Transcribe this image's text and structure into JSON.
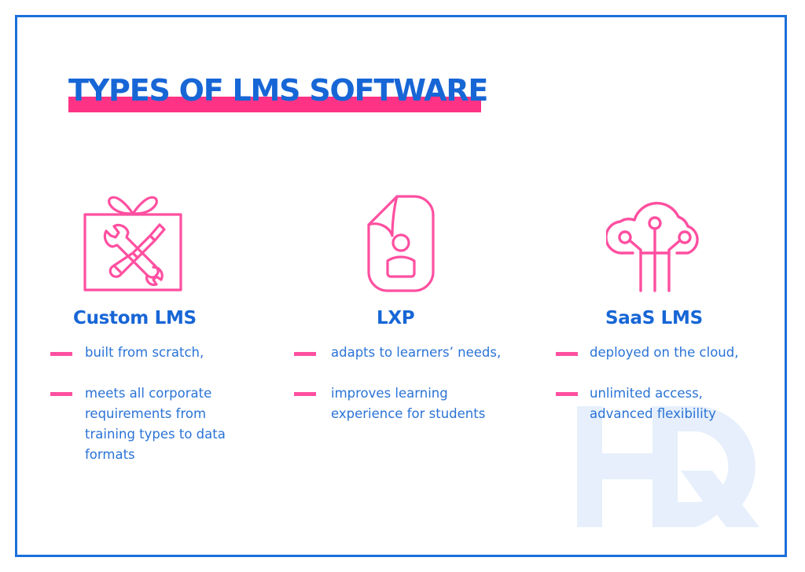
{
  "title": "TYPES OF LMS SOFTWARE",
  "colors": {
    "primary_blue": "#1766d6",
    "text_blue": "#2a73d6",
    "accent_pink": "#ff3386",
    "icon_pink": "#ff4fa0",
    "watermark_blue": "#e6effb"
  },
  "watermark": {
    "text": "HQ"
  },
  "columns": [
    {
      "heading": "Custom LMS",
      "icon": "gift-box-tools-icon",
      "bullets": [
        {
          "line1": "built from scratch,"
        },
        {
          "line1": "meets all corporate",
          "line2": "requirements from",
          "line3": "training types to data",
          "line4": "formats"
        }
      ]
    },
    {
      "heading": "LXP",
      "icon": "user-document-icon",
      "bullets": [
        {
          "line1": "adapts to learners’ needs,"
        },
        {
          "line1": "improves learning",
          "line2": "experience for students"
        }
      ]
    },
    {
      "heading": "SaaS LMS",
      "icon": "cloud-network-icon",
      "bullets": [
        {
          "line1": "deployed on the cloud,"
        },
        {
          "line1": "unlimited access,",
          "line2": "advanced flexibility"
        }
      ]
    }
  ]
}
